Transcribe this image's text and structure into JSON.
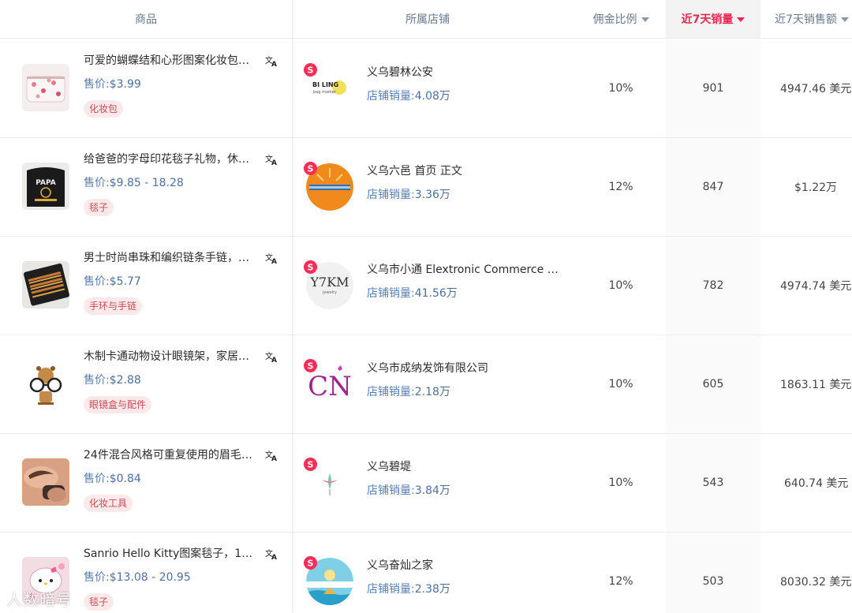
{
  "header": {
    "product": "商品",
    "store": "所属店铺",
    "commission": "佣金比例",
    "sales7d": "近7天销量",
    "revenue7d": "近7天销售额"
  },
  "price_label": "售价:",
  "store_sales_label": "店铺销量:",
  "rows": [
    {
      "name": "可爱的蝴蝶结和心形图案化妆包…",
      "price": "$3.99",
      "tag": "化妆包",
      "store": "义乌碧林公安",
      "store_sales": "4.08万",
      "logo_text": "BI LING",
      "logo_sub": "bag marker",
      "commission": "10%",
      "sales": "901",
      "revenue": "4947.46 美元"
    },
    {
      "name": "给爸爸的字母印花毯子礼物，休…",
      "price": "$9.85 - 18.28",
      "tag": "毯子",
      "store": "义乌六邑 首页 正文",
      "store_sales": "3.36万",
      "thumb_text": "PAPA",
      "commission": "12%",
      "sales": "847",
      "revenue": "$1.22万"
    },
    {
      "name": "男士时尚串珠和编织链条手链，…",
      "price": "$5.77",
      "tag": "手环与手链",
      "store": "义乌市小通 Elextronic Commerce …",
      "store_sales": "41.56万",
      "logo_text": "Y7KM",
      "logo_sub": "jewelry",
      "commission": "10%",
      "sales": "782",
      "revenue": "4974.74 美元"
    },
    {
      "name": "木制卡通动物设计眼镜架，家居…",
      "price": "$2.88",
      "tag": "眼镜盒与配件",
      "store": "义乌市成纳发饰有限公司",
      "store_sales": "2.18万",
      "logo_text": "CN",
      "commission": "10%",
      "sales": "605",
      "revenue": "1863.11 美元"
    },
    {
      "name": "24件混合风格可重复使用的眉毛…",
      "price": "$0.84",
      "tag": "化妆工具",
      "store": "义乌碧堤",
      "store_sales": "3.84万",
      "commission": "10%",
      "sales": "543",
      "revenue": "640.74 美元"
    },
    {
      "name": "Sanrio Hello Kitty图案毯子，1…",
      "price": "$13.08 - 20.95",
      "tag": "毯子",
      "store": "义乌奋灿之家",
      "store_sales": "2.38万",
      "commission": "12%",
      "sales": "503",
      "revenue": "8030.32 美元"
    }
  ],
  "watermark": "人数暗号",
  "colors": {
    "accent": "#e8264f",
    "price_text": "#5a7fb0",
    "tag_bg": "#fde9ea",
    "tag_text": "#c44a58",
    "header_text": "#6a7a90"
  }
}
